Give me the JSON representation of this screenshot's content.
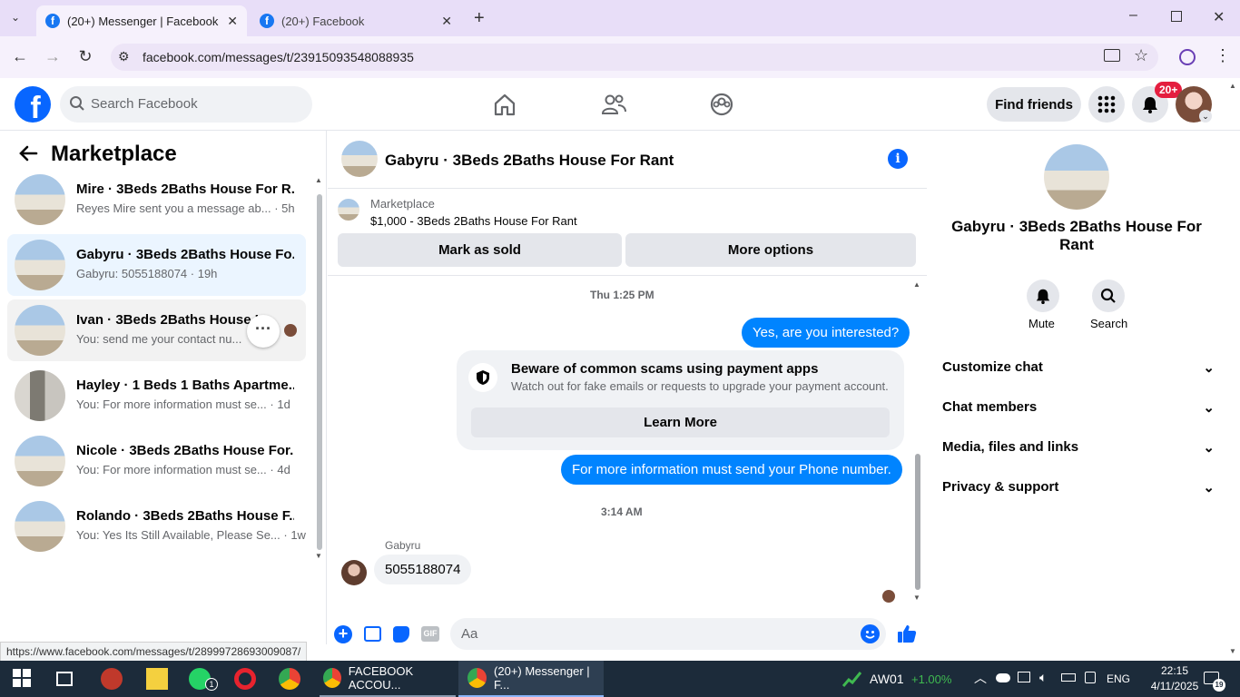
{
  "browser": {
    "tabs": [
      {
        "title": "(20+) Messenger | Facebook",
        "active": true
      },
      {
        "title": "(20+) Facebook",
        "active": false
      }
    ],
    "url": "facebook.com/messages/t/23915093548088935",
    "status_url": "https://www.facebook.com/messages/t/28999728693009087/"
  },
  "header": {
    "search_placeholder": "Search Facebook",
    "find_friends": "Find friends",
    "notif_badge": "20+"
  },
  "sidebar": {
    "title": "Marketplace",
    "conversations": [
      {
        "name": "Mire · 3Beds 2Baths House For R...",
        "preview": "Reyes Mire sent you a message ab...",
        "time": "· 5h"
      },
      {
        "name": "Gabyru · 3Beds 2Baths House Fo...",
        "preview": "Gabyru: 5055188074",
        "time": "· 19h"
      },
      {
        "name": "Ivan · 3Beds 2Baths House Fo",
        "preview": "You: send me your contact nu...",
        "time": ""
      },
      {
        "name": "Hayley · 1 Beds 1 Baths Apartme...",
        "preview": "You: For more information must se...",
        "time": "· 1d"
      },
      {
        "name": "Nicole · 3Beds 2Baths House For...",
        "preview": "You: For more information must se...",
        "time": "· 4d"
      },
      {
        "name": "Rolando · 3Beds 2Baths House F...",
        "preview": "You: Yes Its Still Available, Please Se...",
        "time": "· 1w"
      }
    ]
  },
  "chat": {
    "title": "Gabyru · 3Beds 2Baths House For Rant",
    "listing_source": "Marketplace",
    "listing_title": "$1,000 - 3Beds 2Baths House For Rant",
    "mark_sold": "Mark as sold",
    "more_options": "More options",
    "ts1": "Thu 1:25 PM",
    "msg1": "Yes, are you interested?",
    "scam_title": "Beware of common scams using payment apps",
    "scam_text": "Watch out for fake emails or requests to upgrade your payment account.",
    "learn_more": "Learn More",
    "msg2": "For more information must send your Phone number.",
    "ts2": "3:14 AM",
    "incoming_sender": "Gabyru",
    "incoming_msg": "5055188074",
    "composer_placeholder": "Aa",
    "gif_label": "GIF"
  },
  "details": {
    "name": "Gabyru · 3Beds 2Baths House For Rant",
    "mute": "Mute",
    "search": "Search",
    "sections": [
      "Customize chat",
      "Chat members",
      "Media, files and links",
      "Privacy & support"
    ]
  },
  "taskbar": {
    "app1": "FACEBOOK ACCOU...",
    "app2": "(20+) Messenger | F...",
    "whatsapp_badge": "1",
    "stock_name": "AW01",
    "stock_change": "+1.00%",
    "lang": "ENG",
    "time": "22:15",
    "date": "4/11/2025",
    "notif_count": "19"
  },
  "colors": {
    "fb_blue": "#0866ff",
    "messenger_blue": "#0084ff",
    "taskbar": "#1c2b3a"
  }
}
